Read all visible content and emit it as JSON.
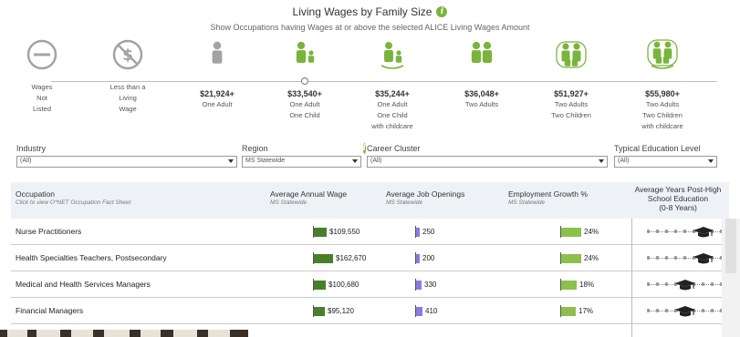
{
  "header": {
    "title": "Living Wages by Family Size",
    "subtitle": "Show Occupations having Wages at or above the selected ALICE Living Wages Amount"
  },
  "colors": {
    "accent": "#7ab43c",
    "icon_gray": "#a3a3a3",
    "bar_wage": "#4a7f2a",
    "bar_openings": "#8a7ae0",
    "bar_growth": "#8cc04b"
  },
  "steps": [
    {
      "icon": "no-wage-circle-icon",
      "value": "",
      "lines": [
        "Wages",
        "Not",
        "Listed"
      ]
    },
    {
      "icon": "no-dollar-icon",
      "value": "",
      "lines": [
        "Less than a",
        "Living",
        "Wage"
      ]
    },
    {
      "icon": "one-adult-icon",
      "value": "$21,924+",
      "lines": [
        "One Adult"
      ]
    },
    {
      "icon": "adult-child-icon",
      "value": "$33,540+",
      "lines": [
        "One Adult",
        "One Child"
      ],
      "selected": true
    },
    {
      "icon": "adult-child-care-icon",
      "value": "$35,244+",
      "lines": [
        "One Adult",
        "One Child",
        "with childcare"
      ]
    },
    {
      "icon": "two-adults-icon",
      "value": "$36,048+",
      "lines": [
        "Two Adults"
      ]
    },
    {
      "icon": "two-adults-two-children-icon",
      "value": "$51,927+",
      "lines": [
        "Two Adults",
        "Two Children"
      ]
    },
    {
      "icon": "family-childcare-icon",
      "value": "$55,980+",
      "lines": [
        "Two Adults",
        "Two Children",
        "with childcare"
      ]
    }
  ],
  "filters": {
    "industry": {
      "label": "Industry",
      "value": "(All)"
    },
    "region": {
      "label": "Region",
      "value": "MS Statewide"
    },
    "career_cluster": {
      "label": "Career Cluster",
      "value": "(All)"
    },
    "education": {
      "label": "Typical Education Level",
      "value": "(All)"
    }
  },
  "table": {
    "columns": {
      "occupation": {
        "label": "Occupation",
        "sub": "Click to view O*NET Occupation Fact Sheet"
      },
      "wage": {
        "label": "Average Annual Wage",
        "sub": "MS Statewide"
      },
      "openings": {
        "label": "Average Job Openings",
        "sub": "MS Statewide"
      },
      "growth": {
        "label": "Employment Growth %",
        "sub": "MS Statewide"
      },
      "years": {
        "line1": "Average Years Post-High",
        "line2": "School Education",
        "line3": "(0-8 Years)"
      }
    },
    "rows": [
      {
        "occupation": "Nurse Practitioners",
        "wage": "$109,550",
        "wage_num": 109550,
        "openings": "250",
        "openings_num": 250,
        "growth": "24%",
        "growth_num": 24,
        "years": 6
      },
      {
        "occupation": "Health Specialties Teachers, Postsecondary",
        "wage": "$162,670",
        "wage_num": 162670,
        "openings": "200",
        "openings_num": 200,
        "growth": "24%",
        "growth_num": 24,
        "years": 6
      },
      {
        "occupation": "Medical and Health Services Managers",
        "wage": "$100,680",
        "wage_num": 100680,
        "openings": "330",
        "openings_num": 330,
        "growth": "18%",
        "growth_num": 18,
        "years": 4
      },
      {
        "occupation": "Financial Managers",
        "wage": "$95,120",
        "wage_num": 95120,
        "openings": "410",
        "openings_num": 410,
        "growth": "17%",
        "growth_num": 17,
        "years": 4
      }
    ]
  }
}
